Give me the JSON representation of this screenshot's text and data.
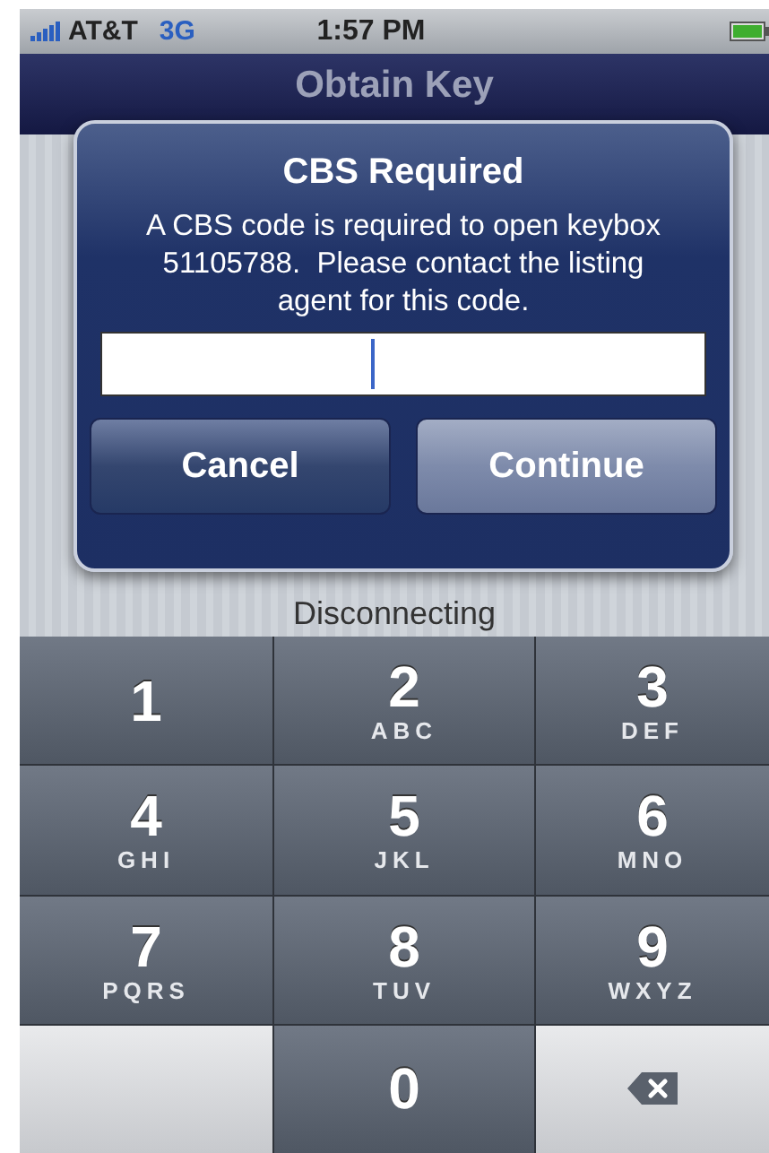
{
  "status_bar": {
    "carrier": "AT&T",
    "network": "3G",
    "time": "1:57 PM"
  },
  "nav_bar": {
    "title": "Obtain Key"
  },
  "status_text": "Disconnecting",
  "alert": {
    "title": "CBS Required",
    "message": "A CBS code is required to open keybox 51105788.  Please contact the listing agent for this code.",
    "field": {
      "focused": true
    },
    "buttons": [
      {
        "label": "Cancel",
        "kind": "cancel"
      },
      {
        "label": "Continue",
        "kind": "default"
      }
    ]
  },
  "keypad": [
    {
      "kind": "digit",
      "digit": "1"
    },
    {
      "kind": "digit",
      "digit": "2",
      "letters": "ABC"
    },
    {
      "kind": "digit",
      "digit": "3",
      "letters": "DEF"
    },
    {
      "kind": "digit",
      "digit": "4",
      "letters": "GHI"
    },
    {
      "kind": "digit",
      "digit": "5",
      "letters": "JKL"
    },
    {
      "kind": "digit",
      "digit": "6",
      "letters": "MNO"
    },
    {
      "kind": "digit",
      "digit": "7",
      "letters": "PQRS"
    },
    {
      "kind": "digit",
      "digit": "8",
      "letters": "TUV"
    },
    {
      "kind": "digit",
      "digit": "9",
      "letters": "WXYZ"
    },
    {
      "kind": "blank"
    },
    {
      "kind": "digit",
      "digit": "0"
    },
    {
      "kind": "delete"
    }
  ]
}
